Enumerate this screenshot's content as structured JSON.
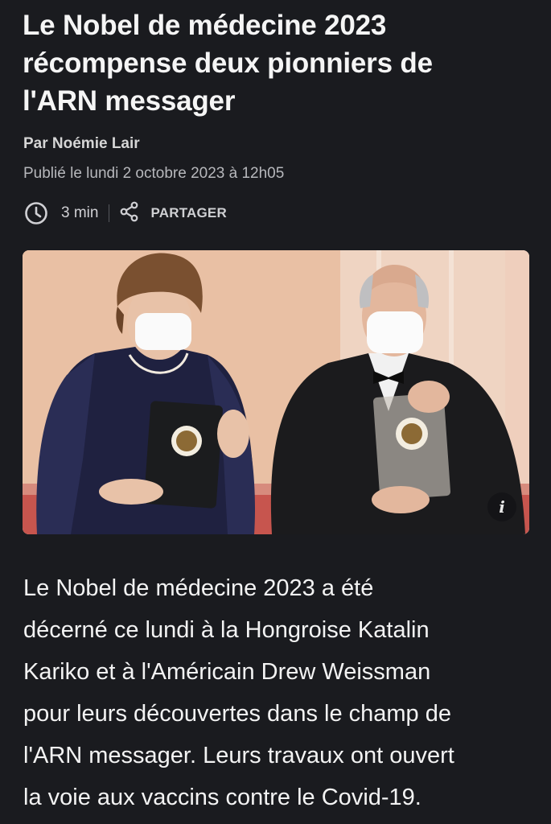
{
  "article": {
    "title": "Le Nobel de médecine 2023\nrécompense deux pionniers de\nl'ARN messager",
    "author": "Par Noémie Lair",
    "published": "Publié le lundi 2 octobre 2023 à 12h05",
    "read_time": "3 min",
    "share_label": "PARTAGER",
    "lead": "Le Nobel de médecine 2023 a été\ndécerné ce lundi à la Hongroise Katalin\nKariko et à l'Américain Drew Weissman\npour leurs découvertes dans le champ de\nl'ARN messager. Leurs travaux ont ouvert\nla voie aux vaccins contre le Covid-19."
  },
  "icons": {
    "clock": "clock-icon",
    "share": "share-icon",
    "info": "info-icon"
  },
  "photo": {
    "info_glyph": "i"
  },
  "colors": {
    "background": "#1a1b1f",
    "text": "#f2f2f2",
    "muted": "#b7b8bc"
  }
}
